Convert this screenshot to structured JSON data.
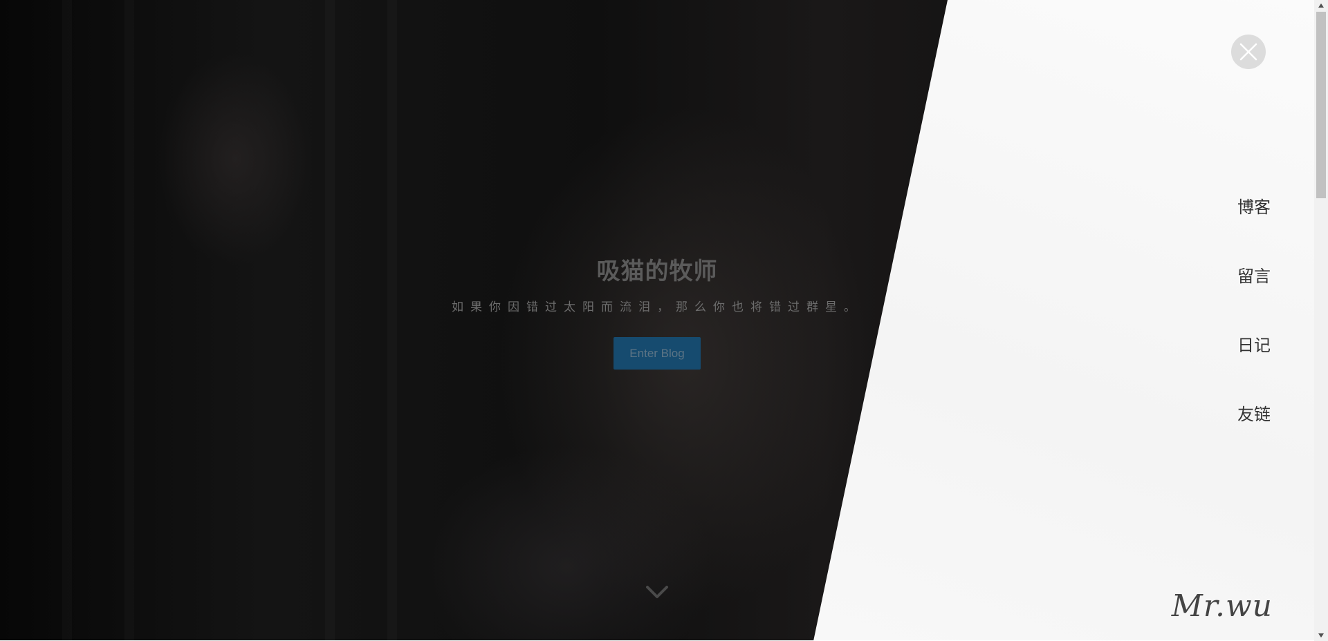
{
  "hero": {
    "title": "吸猫的牧师",
    "motto": "如果你因错过太阳而流泪，那么你也将错过群星。",
    "enter_button": "Enter Blog",
    "scroll_icon": "chevron-down-icon"
  },
  "menu": {
    "close_icon": "close-icon",
    "items": [
      {
        "label": "博客"
      },
      {
        "label": "留言"
      },
      {
        "label": "日记"
      },
      {
        "label": "友链"
      }
    ],
    "signature": "Mr.wu"
  },
  "colors": {
    "button_bg": "#164b6f",
    "panel_bg": "#f6f6f6",
    "close_bg": "#dcdcdc"
  }
}
